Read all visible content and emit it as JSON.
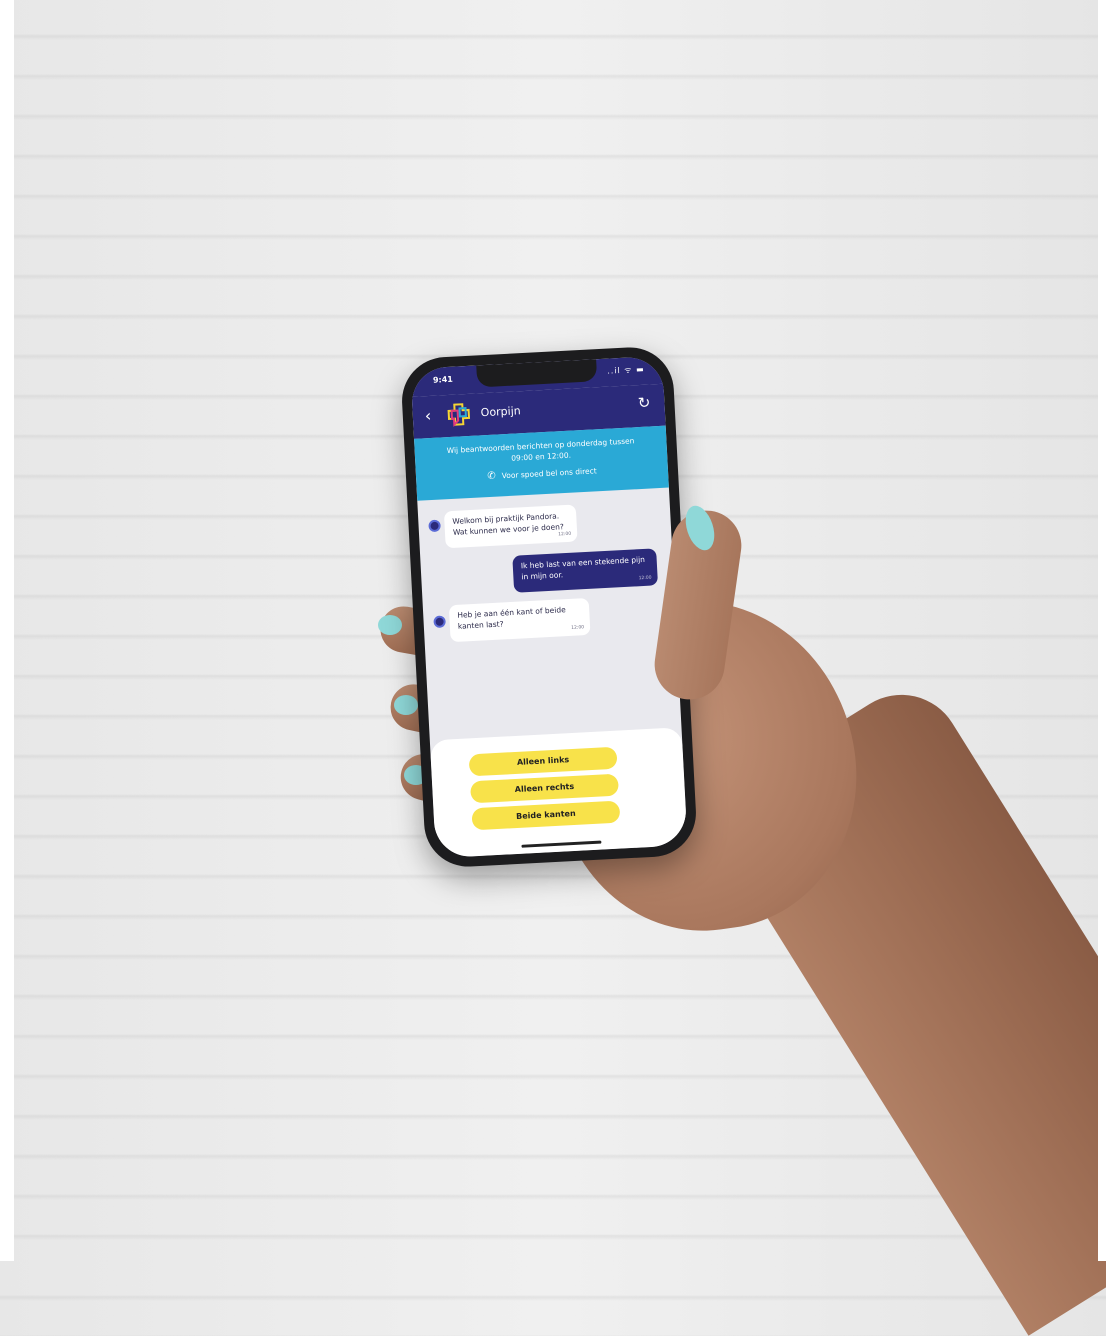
{
  "status_bar": {
    "time": "9:41",
    "icons": "..il ᯤ ▬"
  },
  "app_bar": {
    "back_icon": "‹",
    "title": "Oorpijn",
    "refresh_icon": "↻"
  },
  "banner": {
    "message": "Wij beantwoorden berichten op donderdag tussen 09:00 en 12:00.",
    "call_icon": "✆",
    "call_text": "Voor spoed bel ons direct"
  },
  "messages": [
    {
      "from": "practice",
      "text": "Welkom bij praktijk Pandora. Wat kunnen we voor je doen?",
      "time": "12:00"
    },
    {
      "from": "user",
      "text": "Ik heb last van een stekende pijn in mijn oor.",
      "time": "12:00"
    },
    {
      "from": "practice",
      "text": "Heb je aan één kant of beide kanten last?",
      "time": "12:00"
    }
  ],
  "choices": [
    "Alleen links",
    "Alleen rechts",
    "Beide kanten"
  ],
  "colors": {
    "brand": "#2b2a7a",
    "banner": "#2aa9d6",
    "choice": "#f8e24a"
  }
}
